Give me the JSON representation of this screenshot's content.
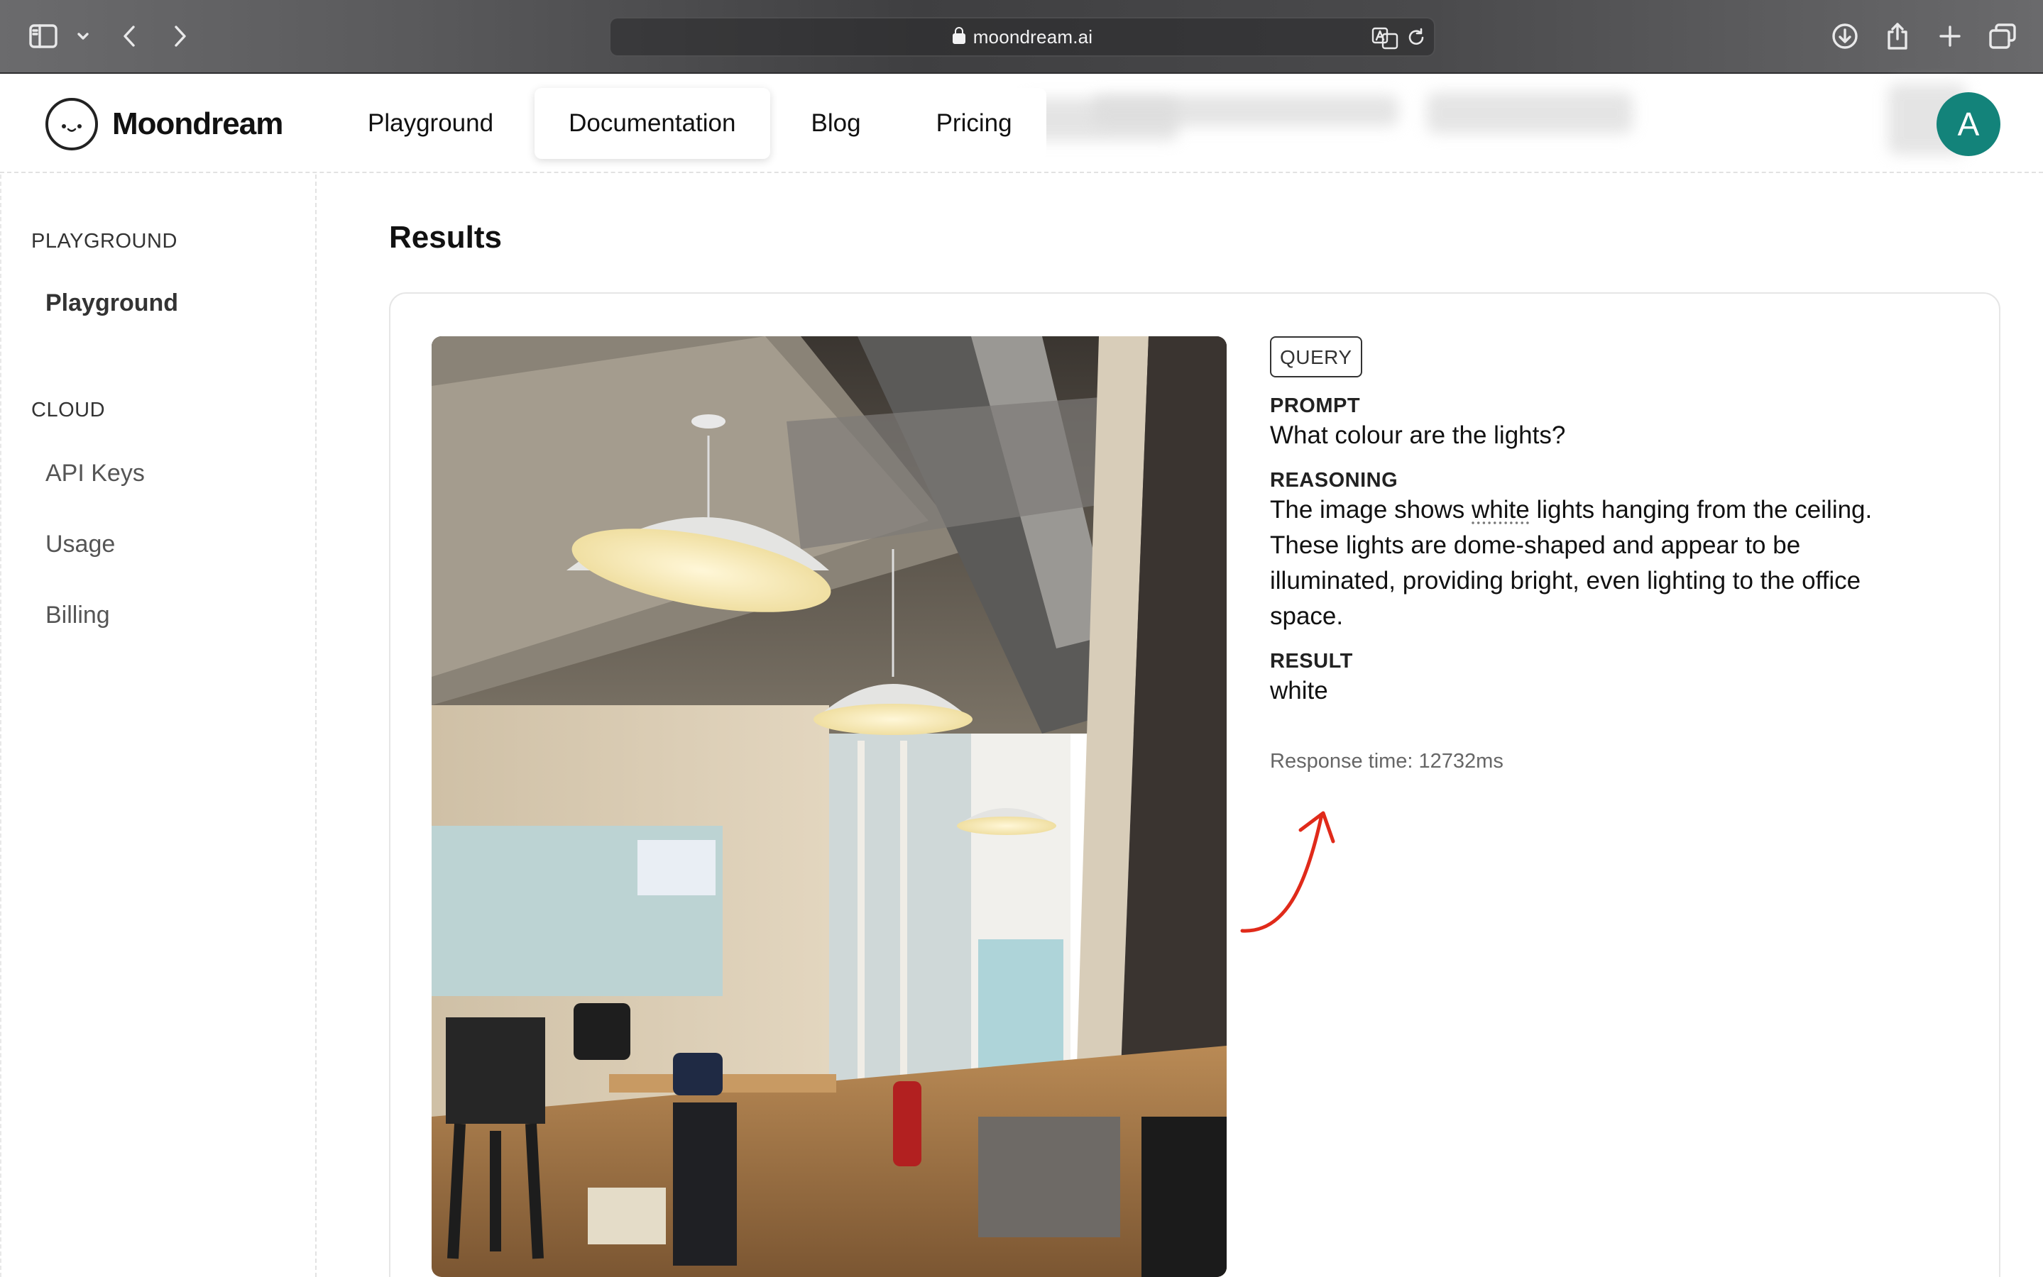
{
  "browser": {
    "url": "moondream.ai"
  },
  "header": {
    "brand": "Moondream",
    "nav": [
      "Playground",
      "Documentation",
      "Blog",
      "Pricing"
    ],
    "active_nav": "Documentation",
    "avatar_initial": "A",
    "avatar_color": "#13837a"
  },
  "sidebar": {
    "sections": [
      {
        "heading": "PLAYGROUND",
        "items": [
          "Playground"
        ]
      },
      {
        "heading": "CLOUD",
        "items": [
          "API Keys",
          "Usage",
          "Billing"
        ]
      }
    ],
    "active_item": "Playground"
  },
  "main": {
    "title": "Results",
    "query_badge": "QUERY",
    "prompt_label": "PROMPT",
    "prompt": "What colour are the lights?",
    "reasoning_label": "REASONING",
    "reasoning_before": "The image shows ",
    "reasoning_highlight": "white",
    "reasoning_after": " lights hanging from the ceiling. These lights are dome-shaped and appear to be illuminated, providing bright, even lighting to the office space.",
    "result_label": "RESULT",
    "result": "white",
    "response_time": "Response time: 12732ms",
    "annotation_color": "#e02a1a"
  }
}
